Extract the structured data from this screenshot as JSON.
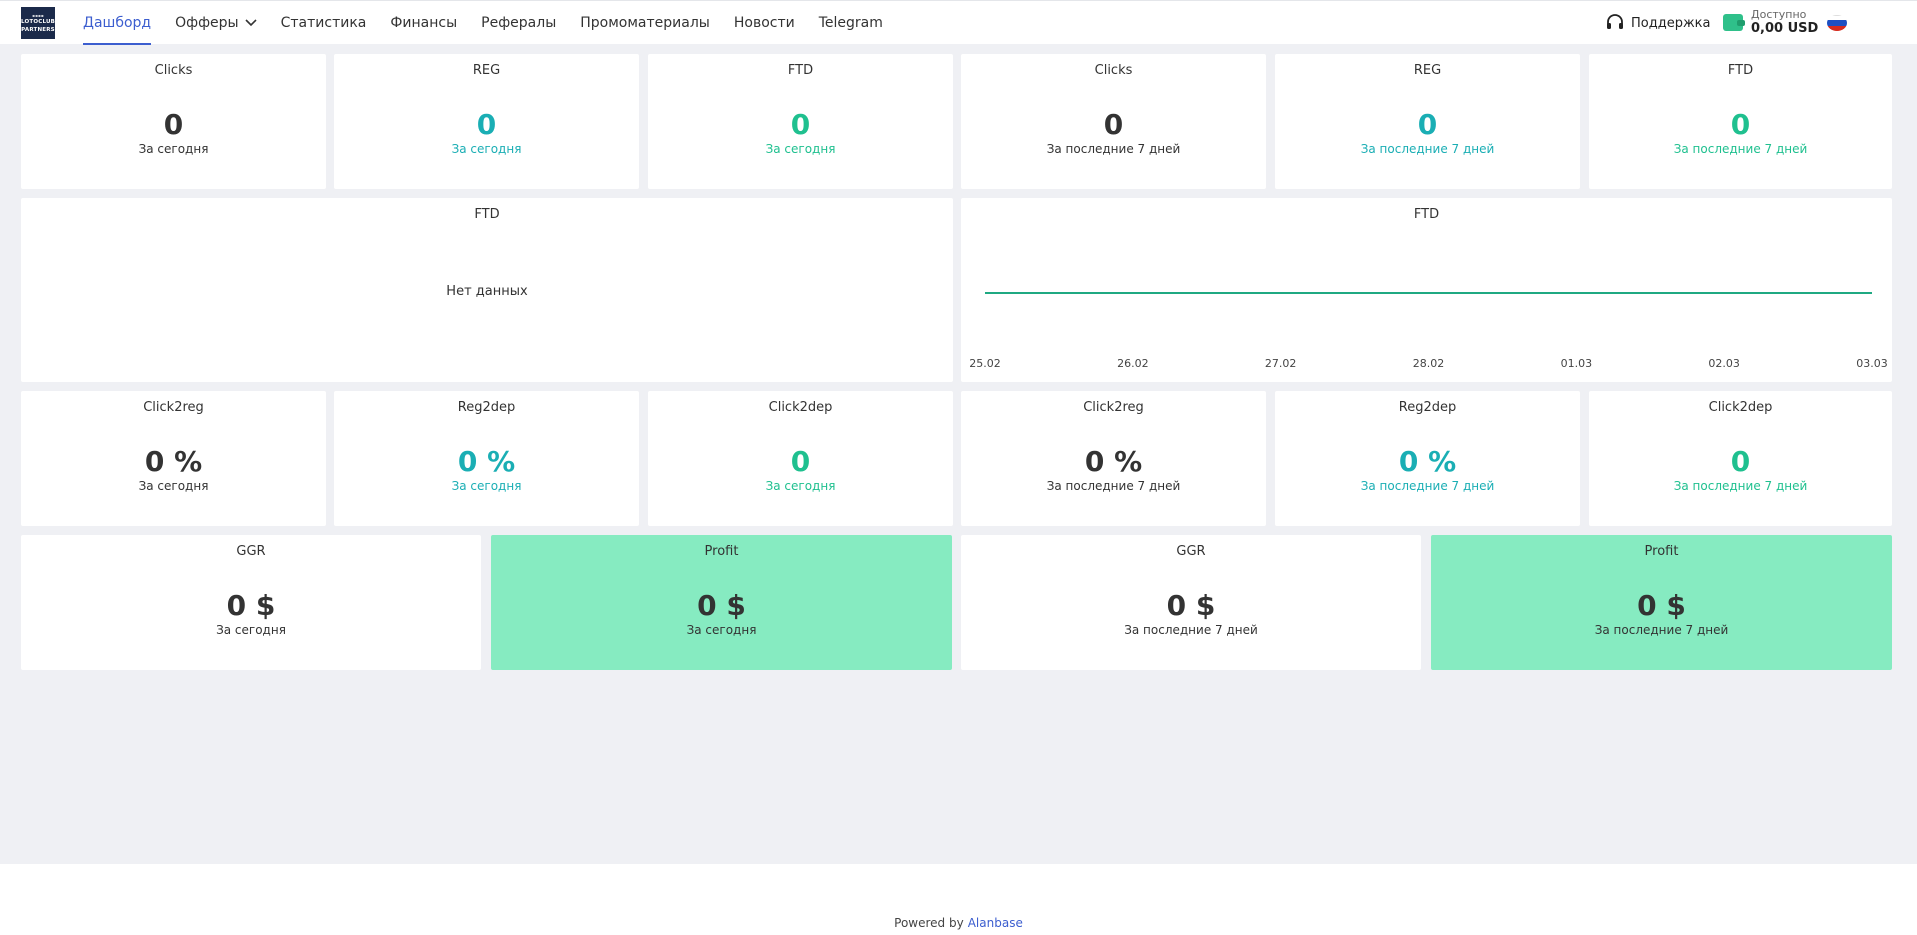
{
  "header": {
    "logo_lines": [
      "LOTOCLUB",
      "PARTNERS"
    ],
    "nav": [
      {
        "label": "Дашборд",
        "active": true
      },
      {
        "label": "Офферы",
        "dropdown": true
      },
      {
        "label": "Статистика"
      },
      {
        "label": "Финансы"
      },
      {
        "label": "Рефералы"
      },
      {
        "label": "Промоматериалы"
      },
      {
        "label": "Новости"
      },
      {
        "label": "Telegram"
      }
    ],
    "support_label": "Поддержка",
    "balance_label": "Доступно",
    "balance_value": "0,00 USD",
    "language_flag": "ru-flag-icon"
  },
  "row1": [
    {
      "title": "Clicks",
      "value": "0",
      "period": "За сегодня"
    },
    {
      "title": "REG",
      "value": "0",
      "period": "За сегодня"
    },
    {
      "title": "FTD",
      "value": "0",
      "period": "За сегодня"
    },
    {
      "title": "Clicks",
      "value": "0",
      "period": "За последние 7 дней"
    },
    {
      "title": "REG",
      "value": "0",
      "period": "За последние 7 дней"
    },
    {
      "title": "FTD",
      "value": "0",
      "period": "За последние 7 дней"
    }
  ],
  "chart_panels": {
    "left": {
      "title": "FTD",
      "empty_text": "Нет данных"
    },
    "right": {
      "title": "FTD"
    }
  },
  "chart_data": {
    "type": "line",
    "title": "FTD",
    "categories": [
      "25.02",
      "26.02",
      "27.02",
      "28.02",
      "01.03",
      "02.03",
      "03.03"
    ],
    "series": [
      {
        "values": [
          0,
          0,
          0,
          0,
          0,
          0,
          0
        ]
      }
    ],
    "line_color": "#1fa982",
    "grid": false
  },
  "row3": [
    {
      "title": "Click2reg",
      "value": "0 %",
      "period": "За сегодня"
    },
    {
      "title": "Reg2dep",
      "value": "0 %",
      "period": "За сегодня"
    },
    {
      "title": "Click2dep",
      "value": "0",
      "period": "За сегодня"
    },
    {
      "title": "Click2reg",
      "value": "0 %",
      "period": "За последние 7 дней"
    },
    {
      "title": "Reg2dep",
      "value": "0 %",
      "period": "За последние 7 дней"
    },
    {
      "title": "Click2dep",
      "value": "0",
      "period": "За последние 7 дней"
    }
  ],
  "row4": [
    {
      "title": "GGR",
      "value": "0 $",
      "period": "За сегодня"
    },
    {
      "title": "Profit",
      "value": "0 $",
      "period": "За сегодня"
    },
    {
      "title": "GGR",
      "value": "0 $",
      "period": "За последние 7 дней"
    },
    {
      "title": "Profit",
      "value": "0 $",
      "period": "За последние 7 дней"
    }
  ],
  "colors": {
    "accent": "#3c5ecf",
    "teal": "#1aaeb4",
    "green": "#1fc08f",
    "profit_bg": "#86ebc1"
  },
  "footer": {
    "powered_by": "Powered by",
    "brand": "Alanbase"
  }
}
